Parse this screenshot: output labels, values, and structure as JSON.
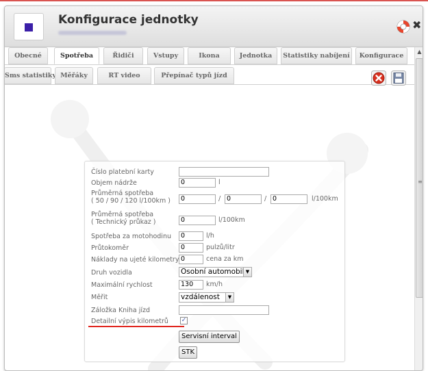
{
  "dialog": {
    "title": "Konfigurace jednotky",
    "icon": "unit-color-square",
    "accent_color": "#3b1fa8"
  },
  "tabs_row1": [
    {
      "label": "Obecné",
      "active": false
    },
    {
      "label": "Spotřeba",
      "active": true
    },
    {
      "label": "Řidiči",
      "active": false
    },
    {
      "label": "Vstupy",
      "active": false
    },
    {
      "label": "Ikona",
      "active": false
    },
    {
      "label": "Jednotka",
      "active": false
    },
    {
      "label": "Statistiky nabíjení",
      "active": false
    },
    {
      "label": "Konfigurace",
      "active": false
    }
  ],
  "tabs_row2": [
    {
      "label": "Sms statistiky",
      "active": false
    },
    {
      "label": "Měřáky",
      "active": false
    },
    {
      "label": "RT video",
      "active": false
    },
    {
      "label": "Přepínač typů jízd",
      "active": false
    }
  ],
  "toolbar": {
    "cancel_icon": "red-cancel-icon",
    "save_icon": "floppy-save-icon"
  },
  "form": {
    "card_number": {
      "label": "Číslo platební karty",
      "value": ""
    },
    "tank_volume": {
      "label": "Objem nádrže",
      "value": "0",
      "unit": "l"
    },
    "avg_consumption": {
      "label_line1": "Průměrná spotřeba",
      "label_line2": "( 50 / 90 / 120 l/100km )",
      "value1": "0",
      "value2": "0",
      "value3": "0",
      "separator": "/",
      "unit": "l/100km"
    },
    "avg_consumption_tp": {
      "label_line1": "Průměrná spotřeba",
      "label_line2": "( Technický průkaz )",
      "value": "0",
      "unit": "l/100km"
    },
    "engine_hour_consumption": {
      "label": "Spotřeba za motohodinu",
      "value": "0",
      "unit": "l/h"
    },
    "flowmeter": {
      "label": "Průtokoměr",
      "value": "0",
      "unit": "pulzů/litr"
    },
    "km_costs": {
      "label": "Náklady na ujeté kilometry",
      "value": "0",
      "unit": "cena za km"
    },
    "vehicle_type": {
      "label": "Druh vozidla",
      "value": "Osobní automobil"
    },
    "max_speed": {
      "label": "Maximální rychlost",
      "value": "130",
      "unit": "km/h"
    },
    "measure": {
      "label": "Měřit",
      "value": "vzdálenost"
    },
    "logbook_tab": {
      "label": "Záložka Kniha jízd",
      "value": ""
    },
    "detailed_km": {
      "label": "Detailní výpis kilometrů",
      "checked": true
    },
    "service_interval_button": "Servisní interval",
    "stk_button": "STK"
  }
}
